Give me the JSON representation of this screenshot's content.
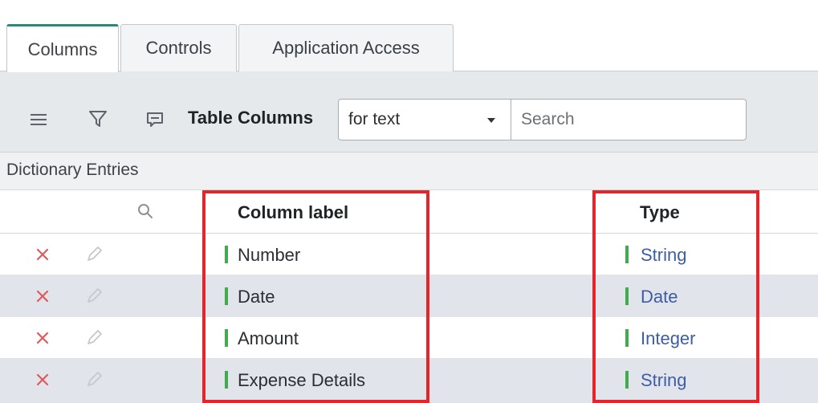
{
  "tabs": [
    {
      "label": "Columns",
      "active": true
    },
    {
      "label": "Controls",
      "active": false
    },
    {
      "label": "Application Access",
      "active": false
    }
  ],
  "toolbar": {
    "icons": [
      "hamburger-menu-icon",
      "filter-funnel-icon",
      "comment-icon"
    ],
    "title": "Table Columns",
    "select_value": "for text",
    "search_placeholder": "Search"
  },
  "section": {
    "title": "Dictionary Entries"
  },
  "table": {
    "columns": [
      "Column label",
      "Type"
    ],
    "rows": [
      {
        "label": "Number",
        "type": "String"
      },
      {
        "label": "Date",
        "type": "Date"
      },
      {
        "label": "Amount",
        "type": "Integer"
      },
      {
        "label": "Expense Details",
        "type": "String"
      }
    ]
  },
  "colors": {
    "active_tab_accent": "#278a7a",
    "marker_green": "#3fae4a",
    "link_blue": "#3d5ea3",
    "delete_red": "#e05a5a",
    "highlight_red": "#e3262c"
  }
}
